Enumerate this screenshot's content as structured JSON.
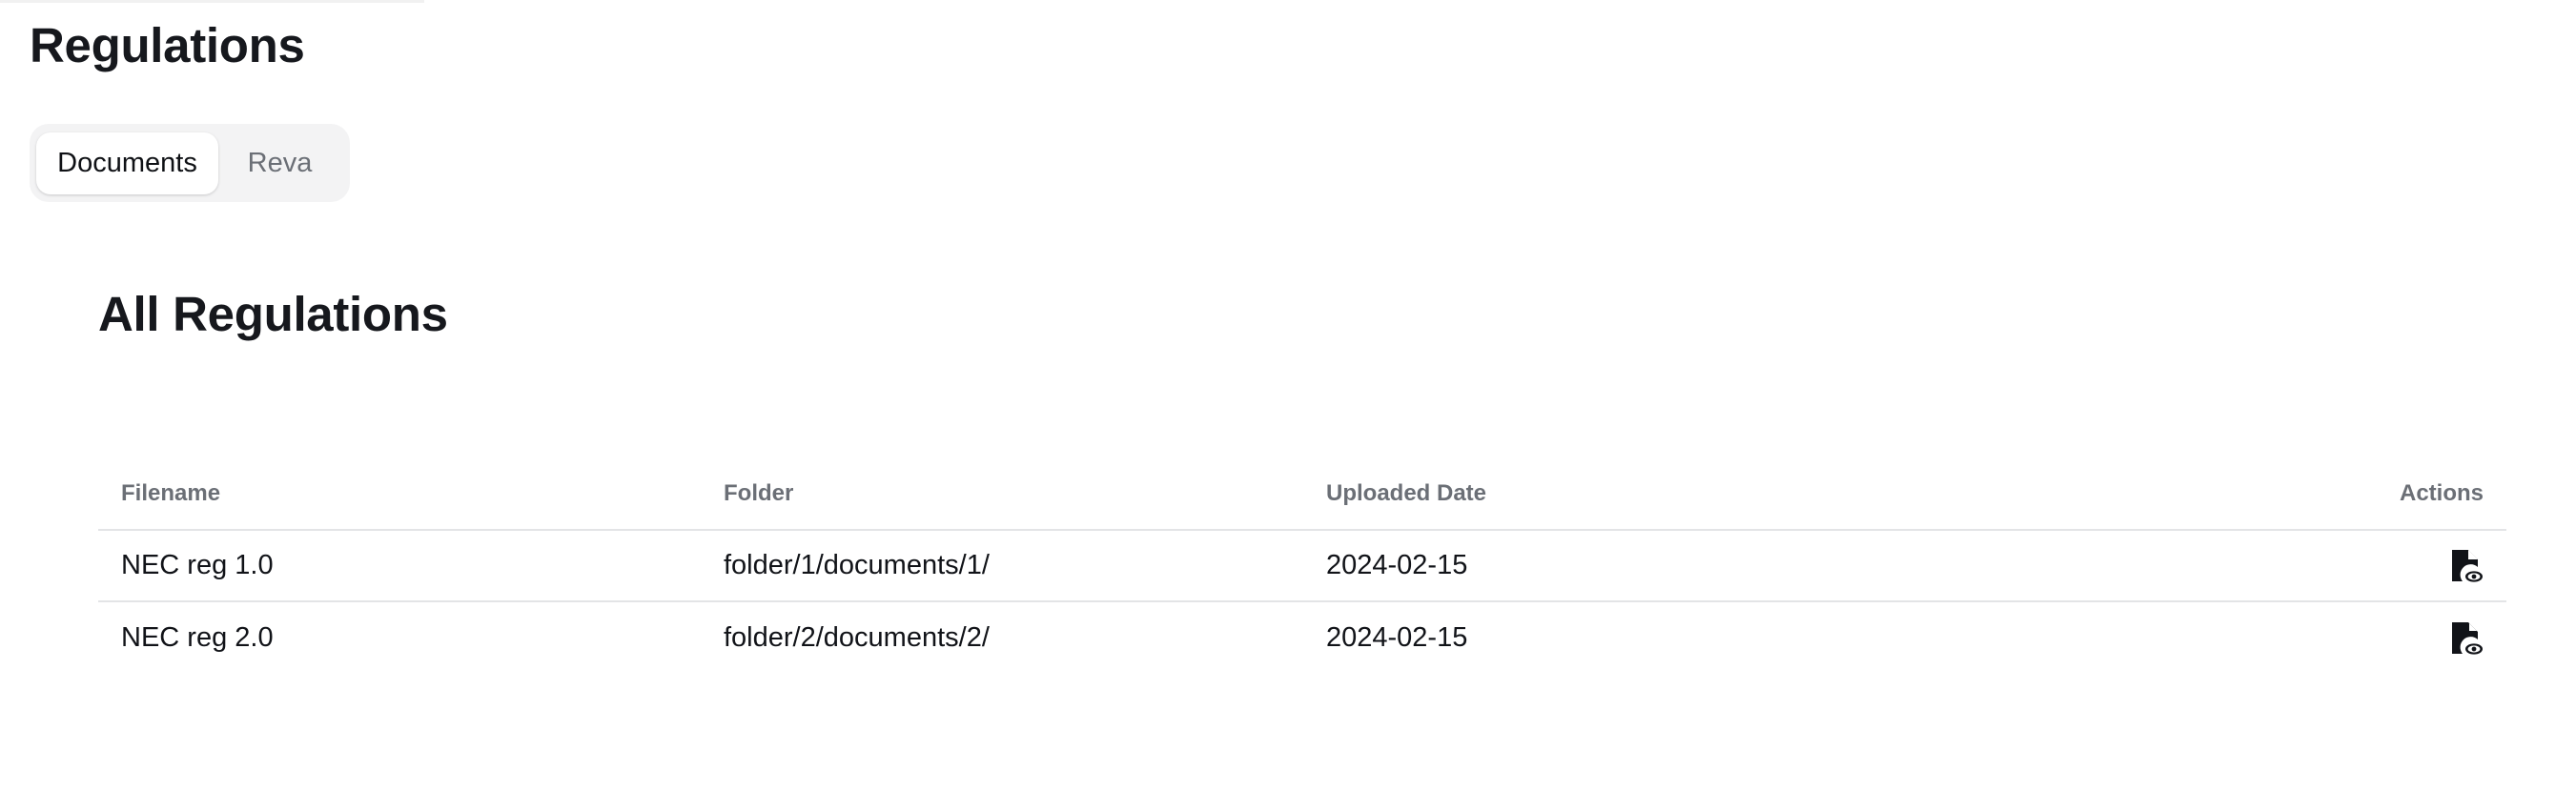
{
  "page": {
    "title": "Regulations"
  },
  "tabs": [
    {
      "label": "Documents",
      "active": true
    },
    {
      "label": "Reva",
      "active": false
    }
  ],
  "section": {
    "title": "All Regulations"
  },
  "table": {
    "headers": {
      "filename": "Filename",
      "folder": "Folder",
      "uploaded": "Uploaded Date",
      "actions": "Actions"
    },
    "rows": [
      {
        "filename": "NEC reg 1.0",
        "folder": "folder/1/documents/1/",
        "uploaded": "2024-02-15",
        "action_icon": "file-eye-icon"
      },
      {
        "filename": "NEC reg 2.0",
        "folder": "folder/2/documents/2/",
        "uploaded": "2024-02-15",
        "action_icon": "file-eye-icon"
      }
    ]
  },
  "colors": {
    "text": "#16181d",
    "muted": "#6b6f76",
    "border": "#e3e4e6",
    "tab_bg": "#f3f3f4"
  }
}
